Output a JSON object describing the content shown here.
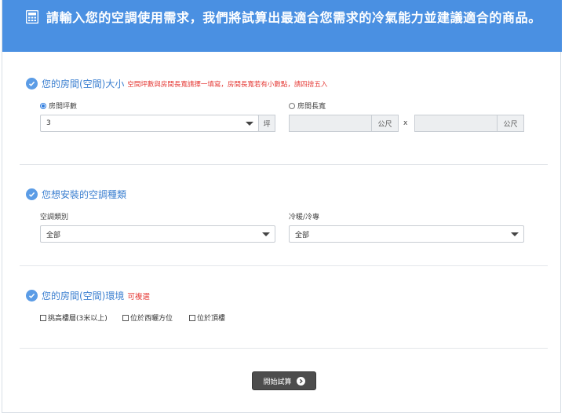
{
  "header": {
    "title": "請輸入您的空調使用需求，我們將試算出最適合您需求的冷氣能力並建議適合的商品。"
  },
  "section1": {
    "title": "您的房間(空間)大小",
    "note": "空間坪數與房間長寬請擇一填寫，房間長寬若有小數點，請四捨五入",
    "opt_ping": {
      "label": "房間坪數",
      "selected": true
    },
    "opt_dims": {
      "label": "房間長寬",
      "selected": false
    },
    "ping_value": "3",
    "ping_unit": "坪",
    "length_unit": "公尺",
    "times": "x",
    "width_unit": "公尺"
  },
  "section2": {
    "title": "您想安裝的空調種類",
    "type_label": "空調類別",
    "type_value": "全部",
    "mode_label": "冷暖/冷專",
    "mode_value": "全部"
  },
  "section3": {
    "title": "您的房間(空間)環境",
    "note": "可複選",
    "options": [
      "挑高樓層(3米以上)",
      "位於西曬方位",
      "位於頂樓"
    ]
  },
  "submit": {
    "label": "開始試算"
  },
  "colors": {
    "header_bg": "#4a90e2",
    "accent_blue": "#3b7fd0",
    "note_red": "#e53935",
    "button_bg": "#4d4d4d"
  }
}
